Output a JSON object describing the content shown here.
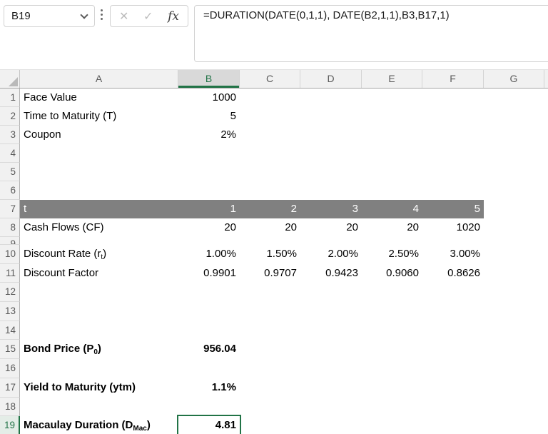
{
  "colors": {
    "accent_green": "#217346",
    "band_gray": "#808080"
  },
  "formula_bar": {
    "name_box_value": "B19",
    "cancel_label": "✕",
    "enter_label": "✓",
    "fx_label": "fx",
    "formula": "=DURATION(DATE(0,1,1), DATE(B2,1,1),B3,B17,1)"
  },
  "sheet": {
    "columns": [
      "A",
      "B",
      "C",
      "D",
      "E",
      "F",
      "G"
    ],
    "selected_column": "B",
    "selected_row": "19",
    "selected_cell": "B19",
    "rows": [
      {
        "n": "1",
        "cells": [
          {
            "col": "A",
            "text": "Face Value"
          },
          {
            "col": "B",
            "text": "1000",
            "num": true
          }
        ]
      },
      {
        "n": "2",
        "cells": [
          {
            "col": "A",
            "text": "Time to Maturity (T)"
          },
          {
            "col": "B",
            "text": "5",
            "num": true
          }
        ]
      },
      {
        "n": "3",
        "cells": [
          {
            "col": "A",
            "text": "Coupon"
          },
          {
            "col": "B",
            "text": "2%",
            "num": true
          }
        ]
      },
      {
        "n": "4",
        "cells": []
      },
      {
        "n": "5",
        "cells": []
      },
      {
        "n": "6",
        "cells": []
      },
      {
        "n": "7",
        "band": true,
        "cells": [
          {
            "col": "A",
            "text": "t"
          },
          {
            "col": "B",
            "text": "1",
            "num": true
          },
          {
            "col": "C",
            "text": "2",
            "num": true
          },
          {
            "col": "D",
            "text": "3",
            "num": true
          },
          {
            "col": "E",
            "text": "4",
            "num": true
          },
          {
            "col": "F",
            "text": "5",
            "num": true
          }
        ]
      },
      {
        "n": "8",
        "cells": [
          {
            "col": "A",
            "text": "Cash Flows (CF)"
          },
          {
            "col": "B",
            "text": "20",
            "num": true
          },
          {
            "col": "C",
            "text": "20",
            "num": true
          },
          {
            "col": "D",
            "text": "20",
            "num": true
          },
          {
            "col": "E",
            "text": "20",
            "num": true
          },
          {
            "col": "F",
            "text": "1020",
            "num": true
          }
        ]
      },
      {
        "n": "9",
        "collapsed": true,
        "cells": []
      },
      {
        "n": "10",
        "cells": [
          {
            "col": "A",
            "parts": [
              {
                "t": "Discount Rate (r"
              },
              {
                "t": "t",
                "sub": true
              },
              {
                "t": ")"
              }
            ]
          },
          {
            "col": "B",
            "text": "1.00%",
            "num": true
          },
          {
            "col": "C",
            "text": "1.50%",
            "num": true
          },
          {
            "col": "D",
            "text": "2.00%",
            "num": true
          },
          {
            "col": "E",
            "text": "2.50%",
            "num": true
          },
          {
            "col": "F",
            "text": "3.00%",
            "num": true
          }
        ]
      },
      {
        "n": "11",
        "cells": [
          {
            "col": "A",
            "text": "Discount Factor"
          },
          {
            "col": "B",
            "text": "0.9901",
            "num": true
          },
          {
            "col": "C",
            "text": "0.9707",
            "num": true
          },
          {
            "col": "D",
            "text": "0.9423",
            "num": true
          },
          {
            "col": "E",
            "text": "0.9060",
            "num": true
          },
          {
            "col": "F",
            "text": "0.8626",
            "num": true
          }
        ]
      },
      {
        "n": "12",
        "cells": []
      },
      {
        "n": "13",
        "cells": []
      },
      {
        "n": "14",
        "cells": []
      },
      {
        "n": "15",
        "cells": [
          {
            "col": "A",
            "bold": true,
            "parts": [
              {
                "t": "Bond Price (P"
              },
              {
                "t": "0",
                "sub": true
              },
              {
                "t": ")"
              }
            ]
          },
          {
            "col": "B",
            "text": "956.04",
            "num": true,
            "bold": true
          }
        ]
      },
      {
        "n": "16",
        "cells": []
      },
      {
        "n": "17",
        "cells": [
          {
            "col": "A",
            "bold": true,
            "text": "Yield to Maturity (ytm)"
          },
          {
            "col": "B",
            "text": "1.1%",
            "num": true,
            "bold": true
          }
        ]
      },
      {
        "n": "18",
        "cells": []
      },
      {
        "n": "19",
        "cells": [
          {
            "col": "A",
            "bold": true,
            "parts": [
              {
                "t": "Macaulay Duration (D"
              },
              {
                "t": "Mac",
                "sub": true
              },
              {
                "t": ")"
              }
            ]
          },
          {
            "col": "B",
            "text": "4.81",
            "num": true,
            "bold": true,
            "selected": true
          }
        ]
      }
    ]
  }
}
